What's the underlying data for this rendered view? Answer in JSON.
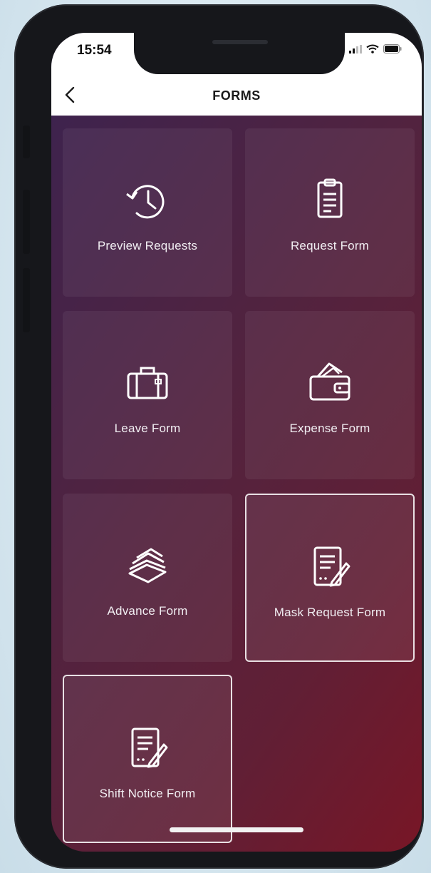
{
  "status_bar": {
    "time": "15:54"
  },
  "header": {
    "title": "FORMS"
  },
  "tiles": [
    {
      "label": "Preview Requests",
      "icon": "history-clock-icon"
    },
    {
      "label": "Request Form",
      "icon": "clipboard-icon"
    },
    {
      "label": "Leave Form",
      "icon": "luggage-icon"
    },
    {
      "label": "Expense Form",
      "icon": "wallet-icon"
    },
    {
      "label": "Advance Form",
      "icon": "cash-stack-icon"
    },
    {
      "label": "Mask Request Form",
      "icon": "document-edit-icon",
      "selected": true
    },
    {
      "label": "Shift Notice Form",
      "icon": "document-edit-icon",
      "selected": true
    }
  ],
  "colors": {
    "gradient_start": "#3b2350",
    "gradient_end": "#781626",
    "tile_text": "#f1eef2"
  }
}
